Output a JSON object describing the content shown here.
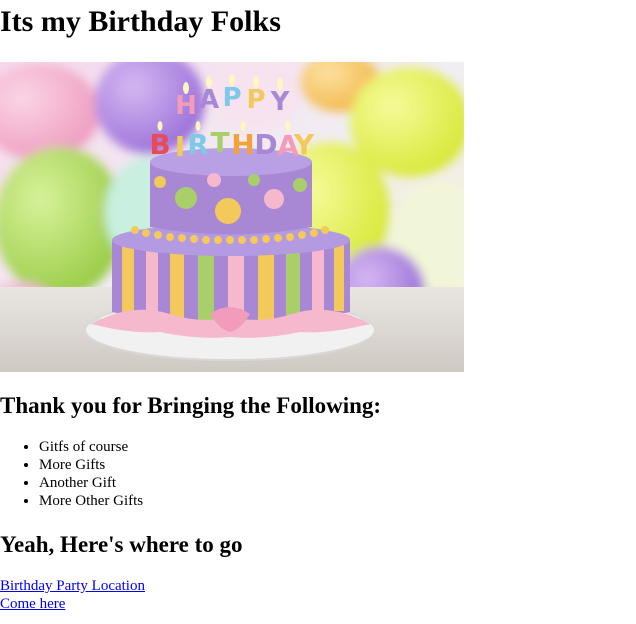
{
  "page": {
    "heading": "Its my Birthday Folks",
    "hero_image": {
      "alt": "",
      "candle_letters": [
        "H",
        "A",
        "P",
        "P",
        "Y",
        "B",
        "I",
        "R",
        "T",
        "H",
        "D",
        "A",
        "Y"
      ],
      "colors": {
        "balloon_purple": "#b58ce6",
        "balloon_yellow": "#e8f24a",
        "balloon_green": "#b6e06a",
        "cake_purple": "#a888d4",
        "stripe_yellow": "#f2c95a",
        "stripe_green": "#a8cf6a",
        "ribbon_pink": "#f5b8cc"
      }
    },
    "thanks_heading": "Thank you for Bringing the Following:",
    "gifts": [
      "Gitfs of course",
      "More Gifts",
      "Another Gift",
      "More Other Gifts"
    ],
    "directions_heading": "Yeah, Here's where to go",
    "links": [
      {
        "label": "Birthday Party Location"
      },
      {
        "label": "Come here"
      }
    ],
    "colors": {
      "link": "#0000ee",
      "text": "#000000",
      "background": "#ffffff"
    }
  }
}
